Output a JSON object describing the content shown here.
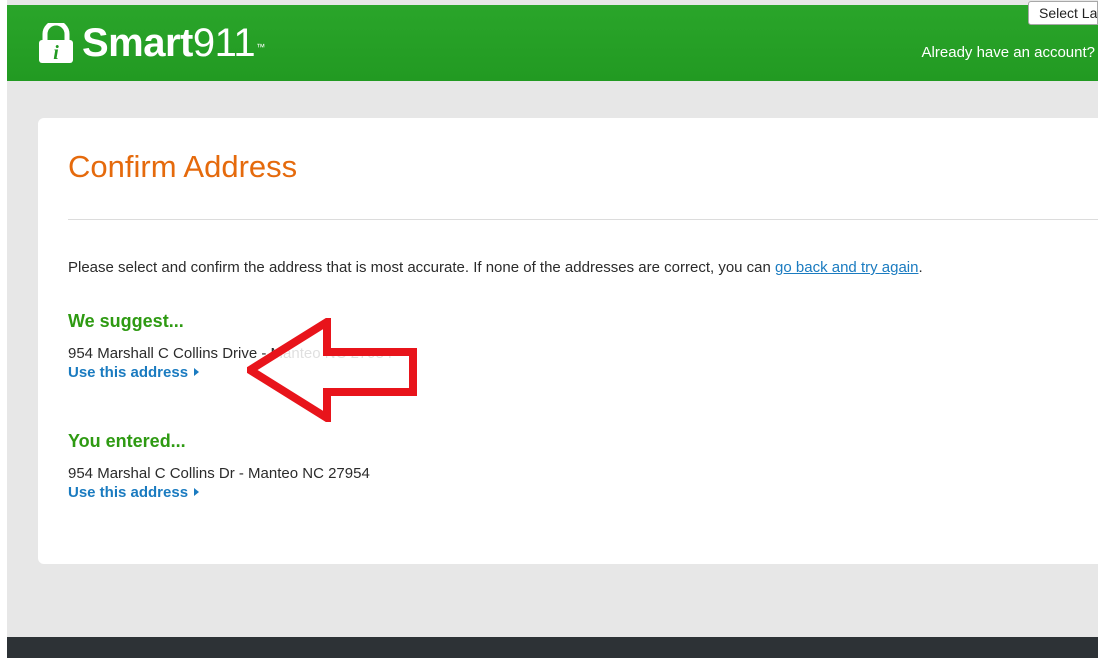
{
  "header": {
    "brand_bold": "Smart",
    "brand_light": "911",
    "trademark": "™",
    "language_button": "Select Language",
    "account_link": "Already have an account?"
  },
  "main": {
    "title": "Confirm Address",
    "instructions_text": "Please select and confirm the address that is most accurate. If none of the addresses are correct, you can ",
    "instructions_link": "go back and try again",
    "instructions_end": ".",
    "suggested": {
      "heading": "We suggest...",
      "address": "954 Marshall C Collins Drive - Manteo NC 27954",
      "action": "Use this address"
    },
    "entered": {
      "heading": "You entered...",
      "address": "954 Marshal C Collins Dr - Manteo NC 27954",
      "action": "Use this address"
    }
  },
  "colors": {
    "header_green": "#229a22",
    "title_orange": "#e56a0c",
    "heading_green": "#2e9a12",
    "link_blue": "#1a7bc0",
    "annotation_red": "#e8141b",
    "footer_dark": "#2d3236"
  },
  "icons": {
    "logo": "lock-info-icon",
    "caret": "caret-right-icon",
    "annotation": "red-arrow-left-icon"
  }
}
